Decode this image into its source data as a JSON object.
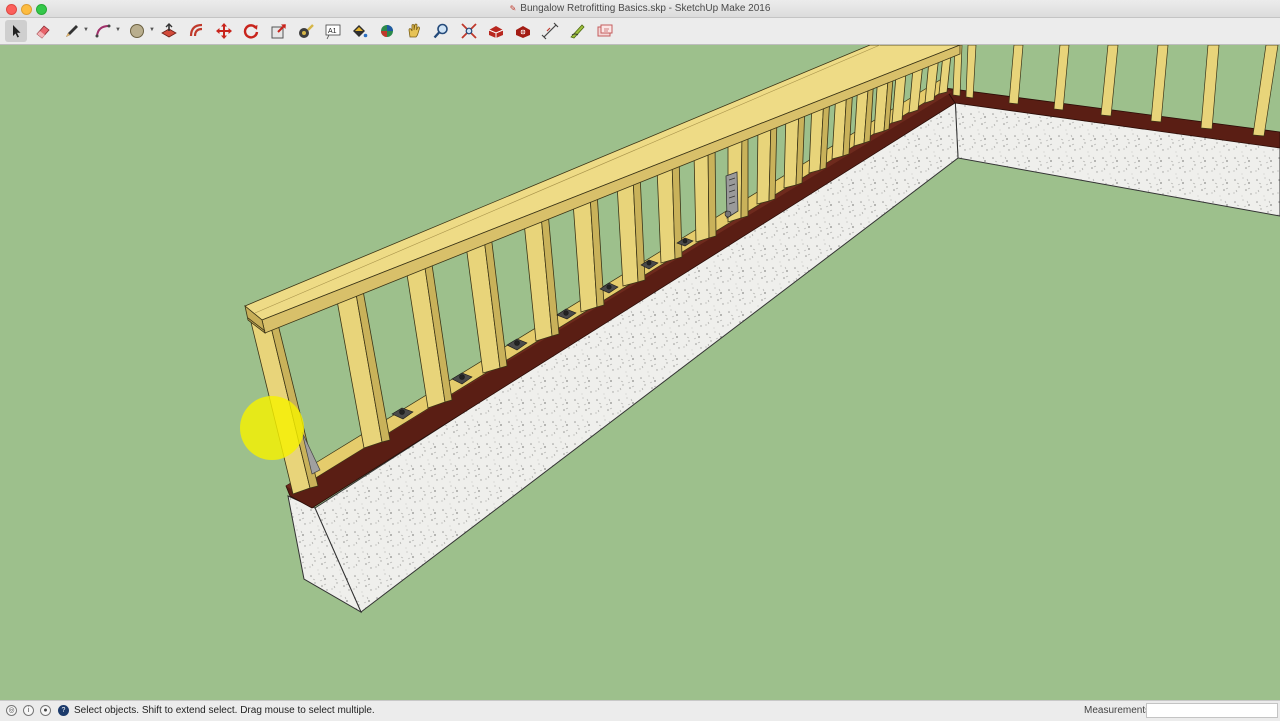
{
  "window": {
    "title": "Bungalow Retrofitting Basics.skp - SketchUp Make 2016"
  },
  "toolbar": {
    "tools": [
      {
        "name": "select-tool",
        "icon": "arrow-cursor-icon",
        "active": true
      },
      {
        "name": "eraser-tool",
        "icon": "eraser-icon"
      },
      {
        "name": "line-tool",
        "icon": "pencil-icon",
        "dropdown": true
      },
      {
        "name": "arc-tool",
        "icon": "arc-icon",
        "dropdown": true
      },
      {
        "name": "shape-tool",
        "icon": "circle-shape-icon",
        "dropdown": true
      },
      {
        "name": "push-pull-tool",
        "icon": "push-pull-icon"
      },
      {
        "name": "offset-tool",
        "icon": "offset-icon"
      },
      {
        "name": "move-tool",
        "icon": "move-arrows-icon"
      },
      {
        "name": "rotate-tool",
        "icon": "rotate-icon"
      },
      {
        "name": "scale-tool",
        "icon": "scale-icon"
      },
      {
        "name": "tape-measure-tool",
        "icon": "tape-measure-icon"
      },
      {
        "name": "text-tool",
        "icon": "text-icon",
        "text": "A1"
      },
      {
        "name": "paint-bucket-tool",
        "icon": "paint-bucket-icon"
      },
      {
        "name": "orbit-tool",
        "icon": "orbit-icon"
      },
      {
        "name": "pan-tool",
        "icon": "hand-icon"
      },
      {
        "name": "zoom-tool",
        "icon": "magnifier-icon"
      },
      {
        "name": "zoom-extents-tool",
        "icon": "zoom-extents-icon"
      },
      {
        "name": "warehouse-tool",
        "icon": "3d-warehouse-icon"
      },
      {
        "name": "extension-warehouse-tool",
        "icon": "extension-warehouse-icon"
      },
      {
        "name": "dimension-tool",
        "icon": "dimension-icon"
      },
      {
        "name": "protractor-tool",
        "icon": "protractor-icon"
      },
      {
        "name": "layout-tool",
        "icon": "send-to-layout-icon"
      }
    ]
  },
  "status": {
    "hint": "Select objects. Shift to extend select. Drag mouse to select multiple."
  },
  "measurements": {
    "label": "Measurements",
    "value": ""
  },
  "colors": {
    "background": "#9dc08c",
    "lumber": "#e8d47a",
    "sill": "#5a1e14",
    "concrete": "#f0f0ee",
    "cursor_highlight": "#f7f200"
  }
}
